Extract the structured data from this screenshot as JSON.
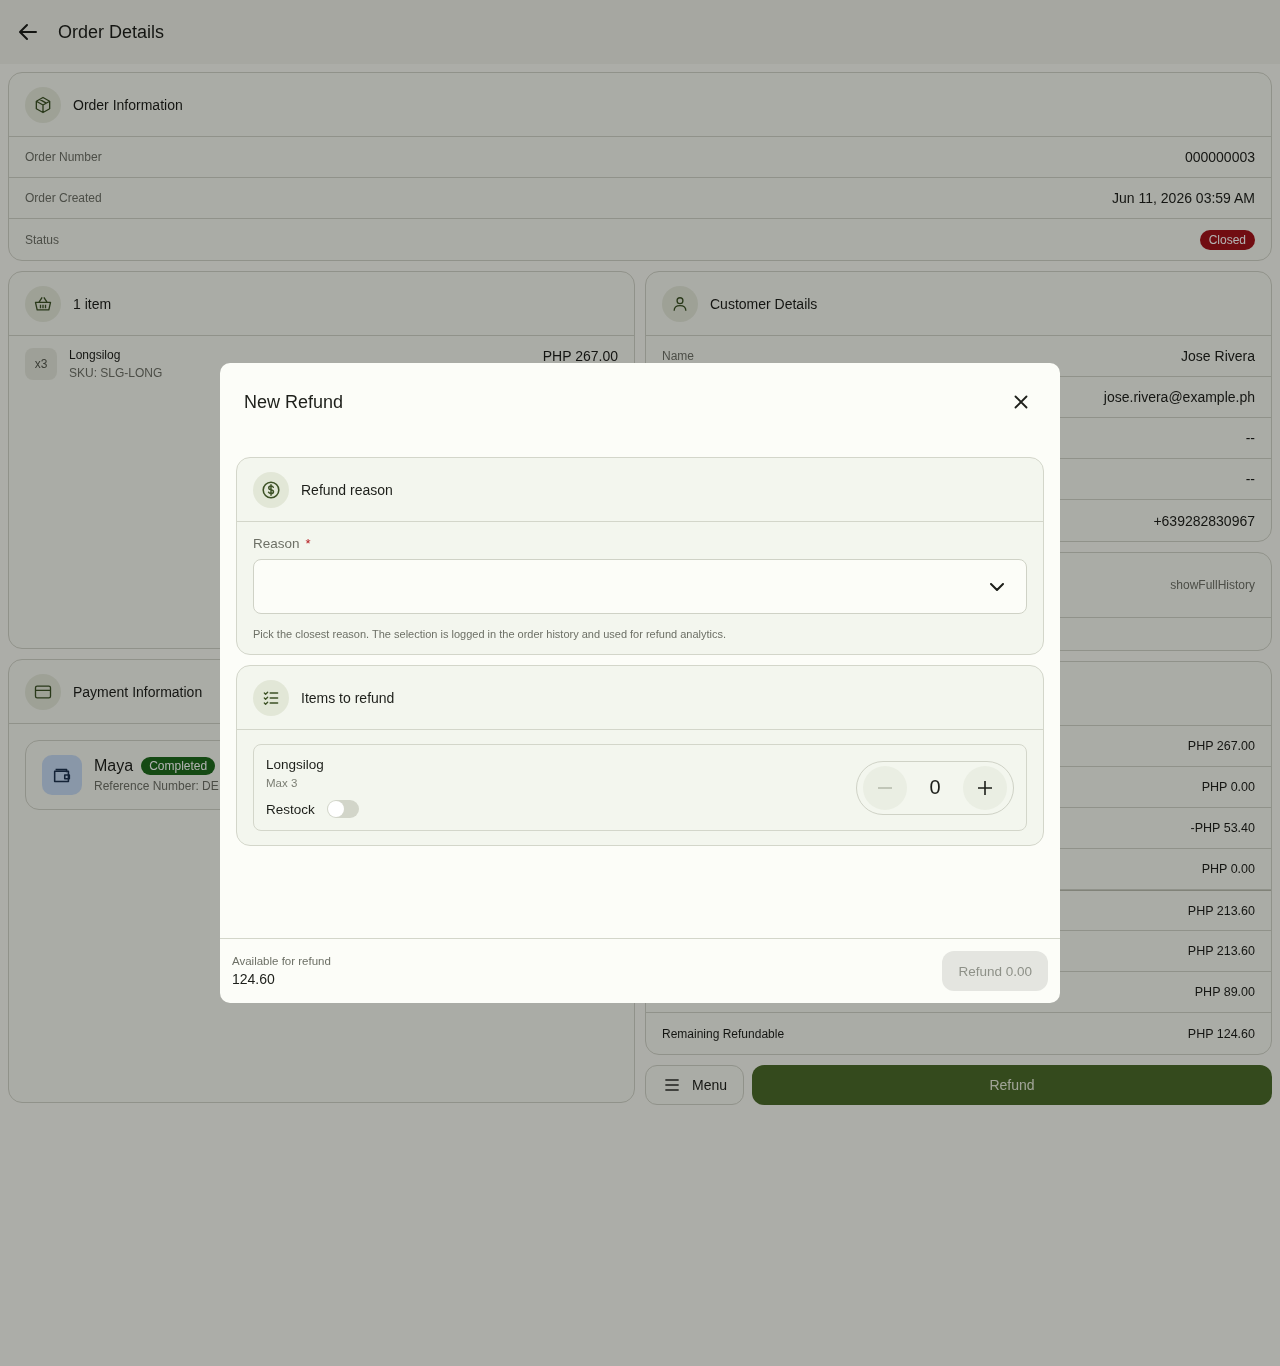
{
  "header": {
    "title": "Order Details"
  },
  "order_information": {
    "title": "Order Information",
    "rows": [
      {
        "label": "Order Number",
        "value": "000000003",
        "kind": "text"
      },
      {
        "label": "Order Created",
        "value": "Jun 11, 2026 03:59 AM",
        "kind": "text"
      },
      {
        "label": "Status",
        "value": "Closed",
        "kind": "badge"
      }
    ]
  },
  "items_card": {
    "title": "1 item",
    "items": [
      {
        "quantity": "x3",
        "name": "Longsilog",
        "sku": "SKU: SLG-LONG",
        "price": "PHP 267.00"
      }
    ]
  },
  "payment": {
    "title": "Payment Information",
    "methods": [
      {
        "name": "Maya",
        "status": "Completed",
        "reference": "Reference Number: DE"
      }
    ]
  },
  "customer": {
    "title": "Customer Details",
    "rows": [
      {
        "label": "Name",
        "value": "Jose Rivera"
      },
      {
        "value": "jose.rivera@example.ph"
      },
      {
        "value": "--"
      },
      {
        "value": "--"
      },
      {
        "value": "+639282830967"
      }
    ]
  },
  "history": {
    "link": "showFullHistory"
  },
  "totals": {
    "rows": [
      {
        "value": "PHP 267.00"
      },
      {
        "value": "PHP 0.00"
      },
      {
        "value": "-PHP 53.40"
      },
      {
        "value": "PHP 0.00"
      },
      {
        "value": "PHP 213.60"
      },
      {
        "value": "PHP 213.60"
      },
      {
        "value": "PHP 89.00"
      },
      {
        "label": "Remaining Refundable",
        "value": "PHP 124.60"
      }
    ]
  },
  "actions": {
    "menu": "Menu",
    "refund": "Refund"
  },
  "modal": {
    "title": "New Refund",
    "reason_section": {
      "title": "Refund reason",
      "label": "Reason",
      "required_mark": "*",
      "helper": "Pick the closest reason. The selection is logged in the order history and used for refund analytics."
    },
    "items_section": {
      "title": "Items to refund",
      "items": [
        {
          "name": "Longsilog",
          "max": "Max 3",
          "restock_label": "Restock",
          "restock": false,
          "quantity": "0"
        }
      ]
    },
    "footer": {
      "available_label": "Available for refund",
      "available": "124.60",
      "button": "Refund 0.00",
      "disabled": true
    }
  }
}
